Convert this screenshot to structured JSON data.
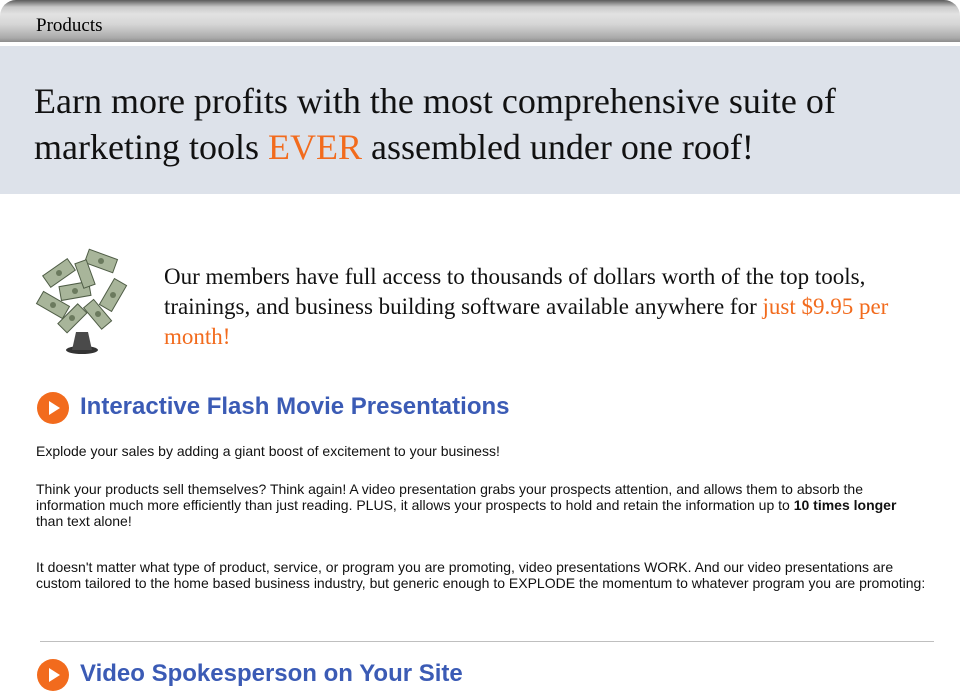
{
  "tab": {
    "label": "Products"
  },
  "hero": {
    "headline_before": "Earn more profits with the most comprehensive suite of marketing tools ",
    "headline_accent": "EVER",
    "headline_after": " assembled under one roof!",
    "accent_color": "#f26b1d"
  },
  "intro": {
    "text": "Our members have full access to thousands of dollars worth of the top tools, trainings, and business building software available anywhere for ",
    "price_text": "just $9.95 per month!",
    "icon": "money-bills-icon"
  },
  "sections": [
    {
      "title": "Interactive Flash Movie Presentations",
      "icon": "orange-play-icon",
      "paragraphs": {
        "p1": "Explode your sales by adding a giant boost of excitement to your business!",
        "p2_before": "Think your products sell themselves? Think again! A video presentation grabs your prospects attention, and allows them to absorb the information much more efficiently than just reading. PLUS, it allows your prospects to hold and retain the information up to ",
        "p2_bold": "10 times longer",
        "p2_after": " than text alone!",
        "p3": "It doesn't matter what type of product, service, or program you are promoting, video presentations WORK. And our video presentations are custom tailored to the home based business industry, but generic enough to EXPLODE the momentum to whatever program you are promoting:"
      }
    },
    {
      "title": "Video Spokesperson on Your Site",
      "icon": "orange-play-icon"
    }
  ],
  "colors": {
    "section_title": "#3b5bb5",
    "hero_background": "#dde2ea",
    "bullet": "#f26b1d"
  }
}
